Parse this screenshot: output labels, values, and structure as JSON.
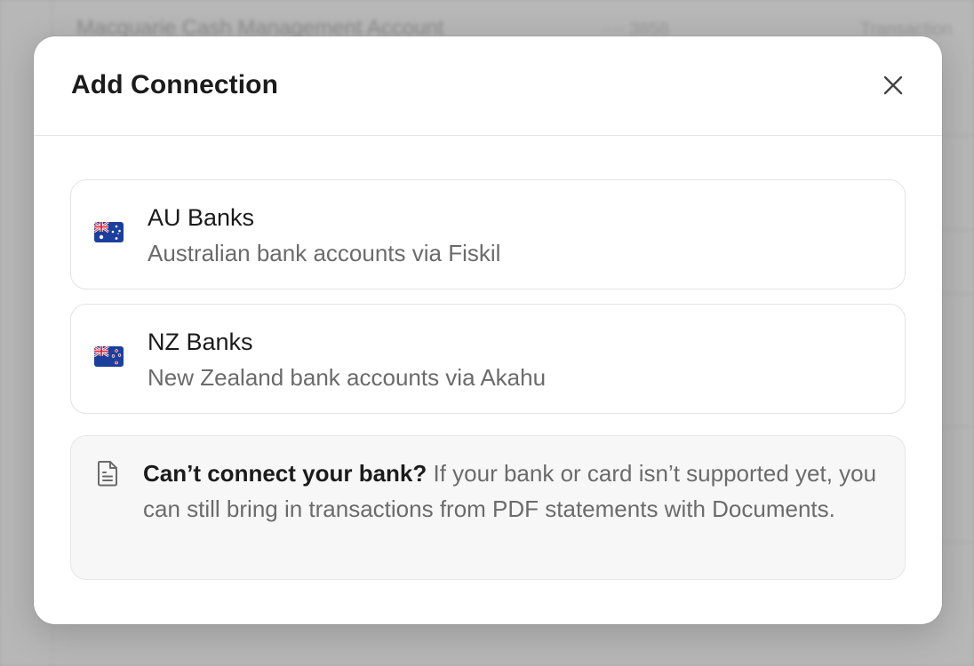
{
  "background": {
    "account_name": "Macquarie Cash Management Account",
    "account_masked": "···· 3858",
    "account_type": "Transaction"
  },
  "modal": {
    "title": "Add Connection",
    "close_icon": "close-icon",
    "options": [
      {
        "flag": "australia-flag-icon",
        "title": "AU Banks",
        "description": "Australian bank accounts via Fiskil"
      },
      {
        "flag": "new-zealand-flag-icon",
        "title": "NZ Banks",
        "description": "New Zealand bank accounts via Akahu"
      }
    ],
    "info": {
      "icon": "document-icon",
      "heading": "Can’t connect your bank?",
      "body": "If your bank or card isn’t supported yet, you can still bring in transactions from PDF statements with Documents."
    }
  },
  "colors": {
    "overlay": "#a9a9a9",
    "modal_bg": "#ffffff",
    "border": "#e3e3e3",
    "muted_text": "#6b6b6b",
    "primary_text": "#1b1b1b",
    "info_bg": "#f7f7f7"
  }
}
